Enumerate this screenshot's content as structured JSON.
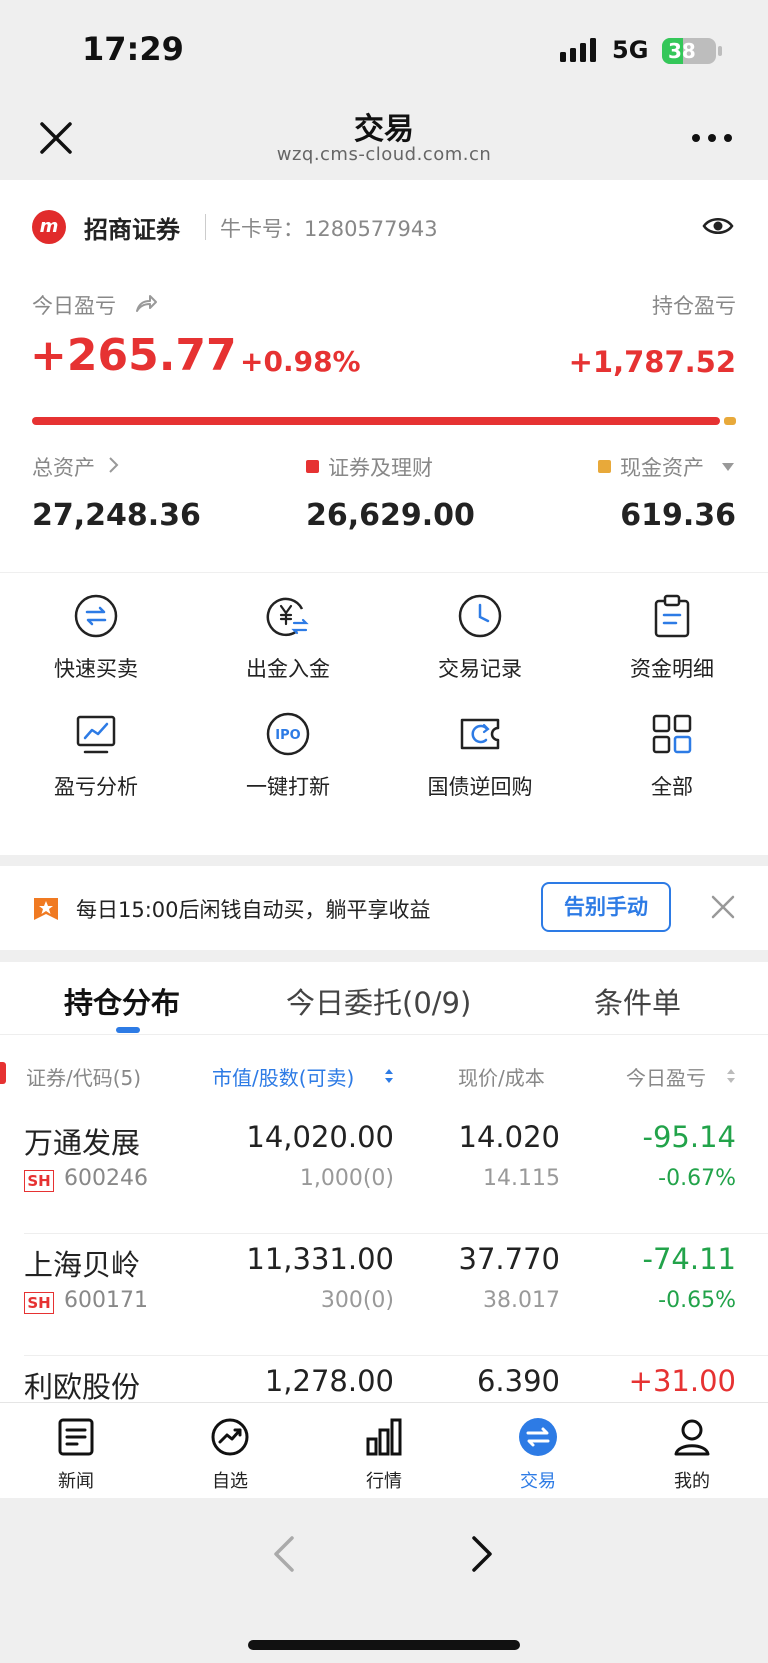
{
  "status_bar": {
    "time": "17:29",
    "network": "5G",
    "battery": "38",
    "battery_level": 0.38
  },
  "title_bar": {
    "title": "交易",
    "domain": "wzq.cms-cloud.com.cn"
  },
  "account": {
    "brand": "招商证券",
    "card_label": "牛卡号：",
    "card_no": "1280577943",
    "today_pnl_label": "今日盈亏",
    "holding_pnl_label": "持仓盈亏",
    "today_pnl": "+265.77",
    "today_pnl_pct": "+0.98%",
    "holding_pnl": "+1,787.52",
    "securities_ratio": 0.977,
    "total_assets_label": "总资产",
    "securities_label": "证券及理财",
    "cash_label": "现金资产",
    "total_assets": "27,248.36",
    "securities": "26,629.00",
    "cash": "619.36"
  },
  "quick_actions": [
    {
      "label": "快速买卖",
      "icon": "swap-circle-icon"
    },
    {
      "label": "出金入金",
      "icon": "yuan-transfer-icon"
    },
    {
      "label": "交易记录",
      "icon": "clock-icon"
    },
    {
      "label": "资金明细",
      "icon": "clipboard-icon"
    },
    {
      "label": "盈亏分析",
      "icon": "chart-monitor-icon"
    },
    {
      "label": "一键打新",
      "icon": "ipo-icon"
    },
    {
      "label": "国债逆回购",
      "icon": "ticket-refresh-icon"
    },
    {
      "label": "全部",
      "icon": "grid-icon"
    }
  ],
  "promo": {
    "text": "每日15:00后闲钱自动买，躺平享收益",
    "button": "告别手动"
  },
  "tabs": [
    "持仓分布",
    "今日委托(0/9)",
    "条件单"
  ],
  "table_headers": {
    "security": "证券/代码(5)",
    "market_value": "市值/股数(可卖)",
    "price": "现价/成本",
    "today_pnl": "今日盈亏"
  },
  "holdings": [
    {
      "name": "万通发展",
      "market": "SH",
      "code": "600246",
      "market_value": "14,020.00",
      "qty": "1,000(0)",
      "price": "14.020",
      "cost": "14.115",
      "pnl": "-95.14",
      "pnl_pct": "-0.67%"
    },
    {
      "name": "上海贝岭",
      "market": "SH",
      "code": "600171",
      "market_value": "11,331.00",
      "qty": "300(0)",
      "price": "37.770",
      "cost": "38.017",
      "pnl": "-74.11",
      "pnl_pct": "-0.65%"
    },
    {
      "name": "利欧股份",
      "market": "",
      "code": "",
      "market_value": "1,278.00",
      "qty": "",
      "price": "6.390",
      "cost": "",
      "pnl": "+31.00",
      "pnl_pct": ""
    }
  ],
  "bottom_nav": [
    {
      "label": "新闻",
      "icon": "news-icon"
    },
    {
      "label": "自选",
      "icon": "trend-circle-icon"
    },
    {
      "label": "行情",
      "icon": "bar-chart-icon"
    },
    {
      "label": "交易",
      "icon": "trade-swap-icon"
    },
    {
      "label": "我的",
      "icon": "person-icon"
    }
  ],
  "colors": {
    "accent": "#2d7be5",
    "up": "#e63232",
    "down": "#22a34a",
    "cash": "#e8a93a"
  }
}
